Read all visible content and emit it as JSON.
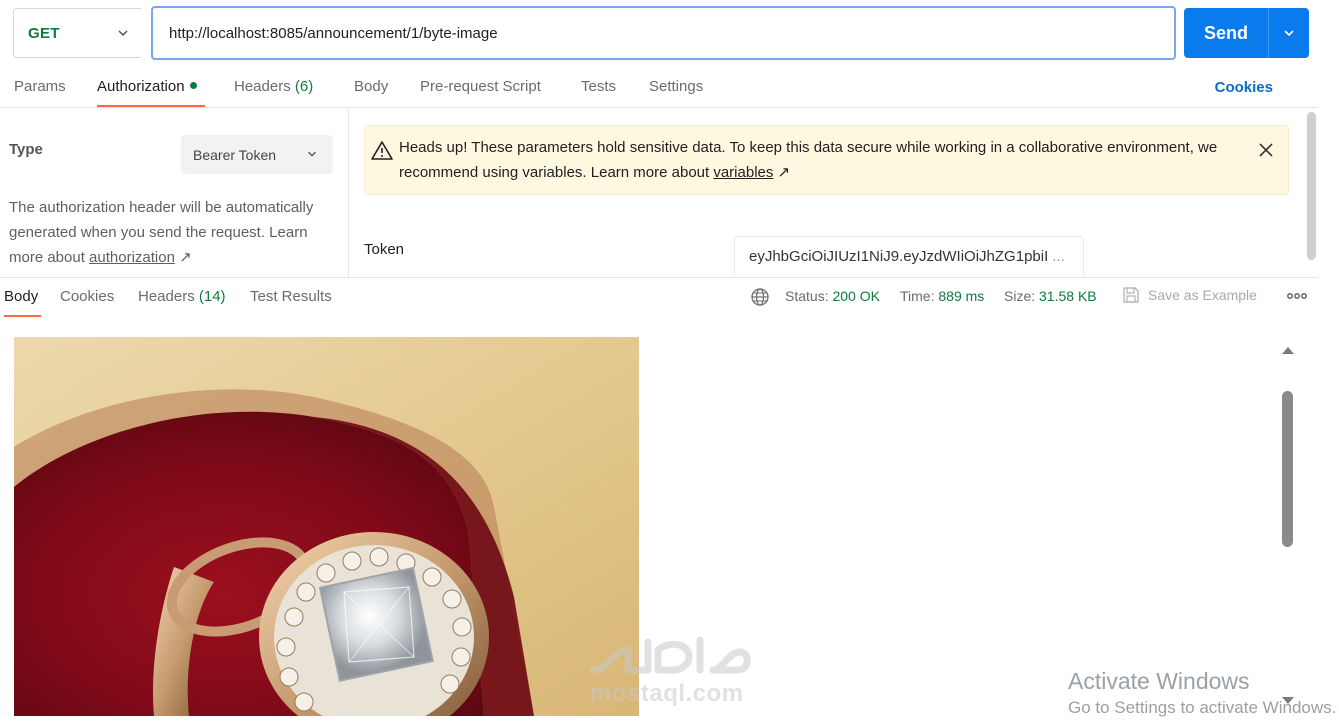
{
  "request": {
    "method": "GET",
    "url": "http://localhost:8085/announcement/1/byte-image",
    "send_label": "Send"
  },
  "request_tabs": {
    "params": "Params",
    "authorization": "Authorization",
    "headers_label": "Headers",
    "headers_count": "(6)",
    "body": "Body",
    "pre_request": "Pre-request Script",
    "tests": "Tests",
    "settings": "Settings",
    "cookies": "Cookies"
  },
  "auth": {
    "type_label": "Type",
    "type_value": "Bearer Token",
    "description": "The authorization header will be automatically generated when you send the request. Learn more about ",
    "description_link": "authorization",
    "description_arrow": "↗",
    "warning_text": "Heads up! These parameters hold sensitive data. To keep this data secure while working in a collaborative environment, we recommend using variables. Learn more about ",
    "warning_link": "variables",
    "warning_arrow": "↗",
    "token_label": "Token",
    "token_value": "eyJhbGciOiJIUzI1NiJ9.eyJzdWIiOiJhZG1pbiI",
    "token_ellipsis": "..."
  },
  "response_tabs": {
    "body": "Body",
    "cookies": "Cookies",
    "headers_label": "Headers",
    "headers_count": "(14)",
    "test_results": "Test Results"
  },
  "response_meta": {
    "status_label": "Status:",
    "status_value": "200 OK",
    "time_label": "Time:",
    "time_value": "889 ms",
    "size_label": "Size:",
    "size_value": "31.58 KB",
    "save_example": "Save as Example"
  },
  "overlay": {
    "activate_title": "Activate Windows",
    "activate_sub": "Go to Settings to activate Windows.",
    "watermark_latin": "mostaql.com"
  },
  "colors": {
    "accent_orange": "#ff6c37",
    "send_blue": "#097bed",
    "status_green": "#0f7b3f",
    "link_blue": "#0b6bcb",
    "warning_bg": "#fff8e1"
  },
  "icons": [
    "chevron-down-icon",
    "warning-icon",
    "close-icon",
    "globe-icon",
    "save-icon",
    "more-icon",
    "external-link-icon"
  ]
}
